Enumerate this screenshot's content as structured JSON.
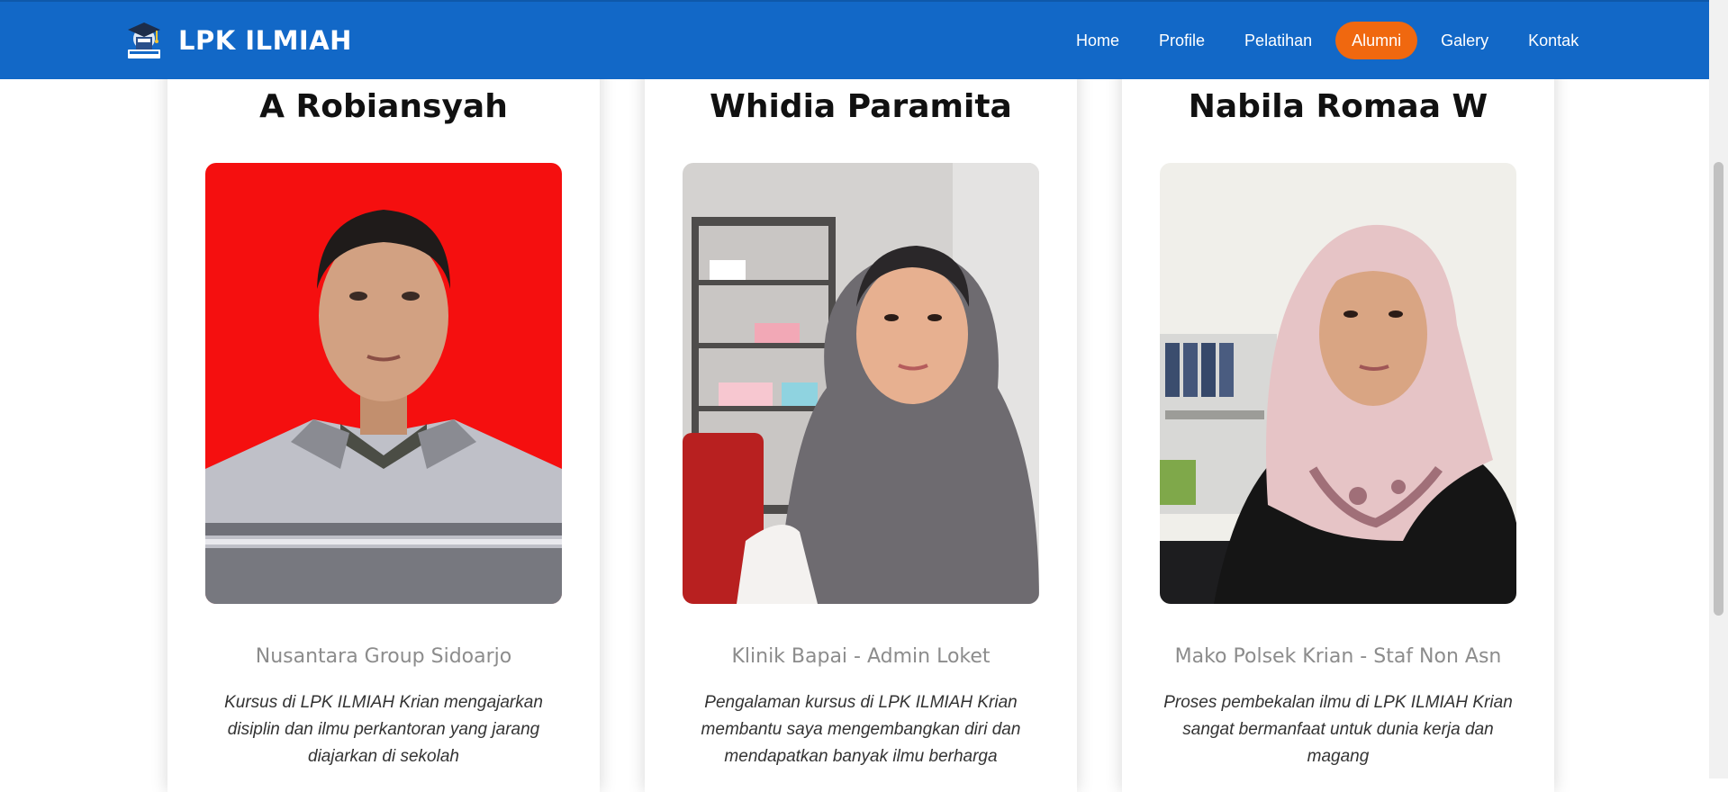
{
  "brand": {
    "name": "LPK ILMIAH",
    "logo_icon": "graduation-book-logo-icon"
  },
  "nav": {
    "items": [
      {
        "label": "Home",
        "active": false
      },
      {
        "label": "Profile",
        "active": false
      },
      {
        "label": "Pelatihan",
        "active": false
      },
      {
        "label": "Alumni",
        "active": true
      },
      {
        "label": "Galery",
        "active": false
      },
      {
        "label": "Kontak",
        "active": false
      }
    ]
  },
  "colors": {
    "navbar": "#1268c7",
    "active_pill": "#f0680f",
    "job_text": "#8c8c8c"
  },
  "alumni": [
    {
      "name": "A Robiansyah",
      "photo": "portrait-man-red-background",
      "job": "Nusantara Group Sidoarjo",
      "quote": "Kursus di LPK ILMIAH Krian mengajarkan disiplin dan ilmu perkantoran yang jarang diajarkan di sekolah"
    },
    {
      "name": "Whidia Paramita",
      "photo": "portrait-woman-grey-hijab",
      "job": "Klinik Bapai - Admin Loket",
      "quote": "Pengalaman kursus di LPK ILMIAH Krian membantu saya mengembangkan diri dan mendapatkan banyak ilmu berharga"
    },
    {
      "name": "Nabila Romaa W",
      "photo": "portrait-woman-pink-hijab",
      "job": "Mako Polsek Krian - Staf Non Asn",
      "quote": "Proses pembekalan ilmu di LPK ILMIAH Krian sangat bermanfaat untuk dunia kerja dan magang"
    }
  ]
}
